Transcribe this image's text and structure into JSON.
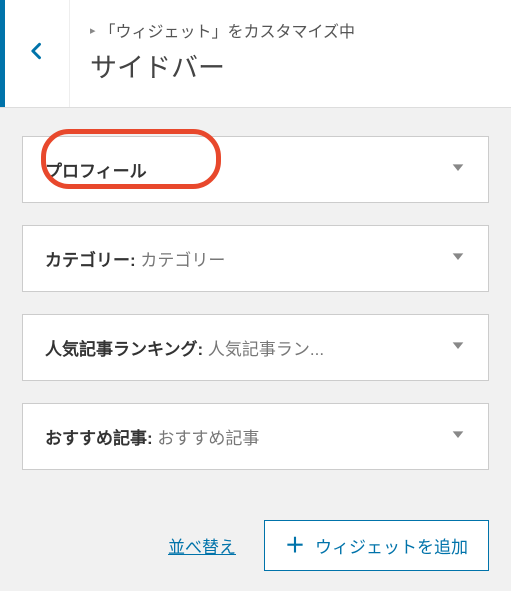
{
  "header": {
    "breadcrumb": "「ウィジェット」をカスタマイズ中",
    "title": "サイドバー"
  },
  "widgets": [
    {
      "name": "プロフィール",
      "value": "",
      "highlighted": true
    },
    {
      "name": "カテゴリー",
      "value": "カテゴリー"
    },
    {
      "name": "人気記事ランキング",
      "value": "人気記事ラン..."
    },
    {
      "name": "おすすめ記事",
      "value": "おすすめ記事"
    }
  ],
  "footer": {
    "reorder": "並べ替え",
    "add_widget": "ウィジェットを追加"
  },
  "colors": {
    "accent": "#0073aa",
    "highlight": "#e8482c"
  }
}
